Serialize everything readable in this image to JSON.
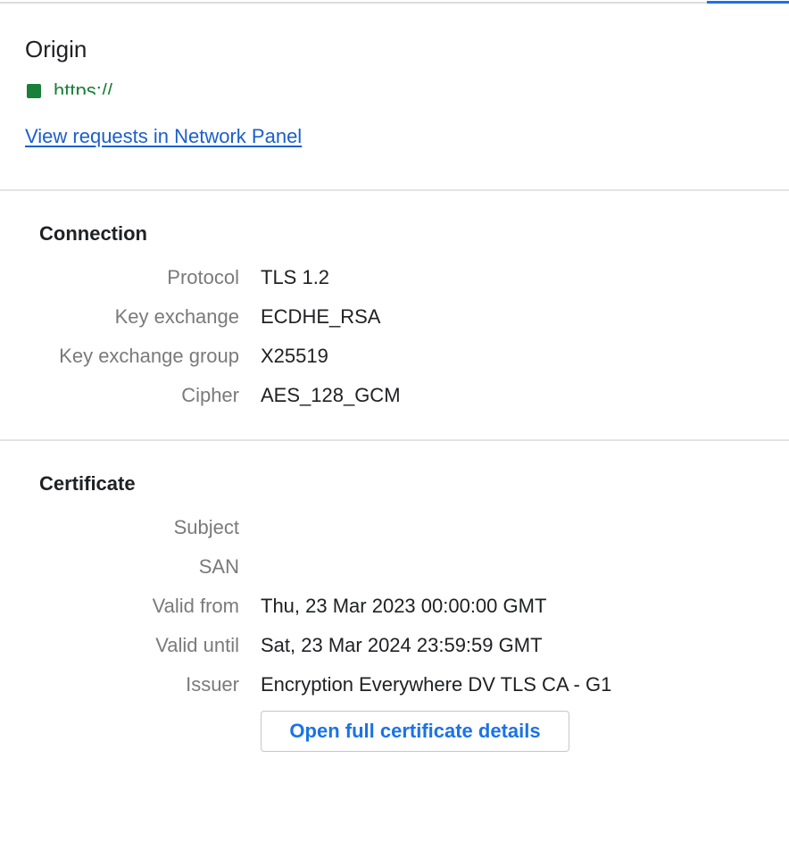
{
  "origin": {
    "title": "Origin",
    "url": "https://",
    "view_requests_label": "View requests in Network Panel"
  },
  "connection": {
    "title": "Connection",
    "rows": [
      {
        "label": "Protocol",
        "value": "TLS 1.2"
      },
      {
        "label": "Key exchange",
        "value": "ECDHE_RSA"
      },
      {
        "label": "Key exchange group",
        "value": "X25519"
      },
      {
        "label": "Cipher",
        "value": "AES_128_GCM"
      }
    ]
  },
  "certificate": {
    "title": "Certificate",
    "rows": [
      {
        "label": "Subject",
        "value": ""
      },
      {
        "label": "SAN",
        "value": ""
      },
      {
        "label": "Valid from",
        "value": "Thu, 23 Mar 2023 00:00:00 GMT"
      },
      {
        "label": "Valid until",
        "value": "Sat, 23 Mar 2024 23:59:59 GMT"
      },
      {
        "label": "Issuer",
        "value": "Encryption Everywhere DV TLS CA - G1"
      }
    ],
    "open_details_label": "Open full certificate details"
  },
  "colors": {
    "secure_green": "#188038",
    "link_blue": "#1a5fcc",
    "button_blue": "#1a73e8",
    "label_gray": "#7a7a7a"
  },
  "icons": {
    "secure_indicator": "secure-origin-icon"
  }
}
